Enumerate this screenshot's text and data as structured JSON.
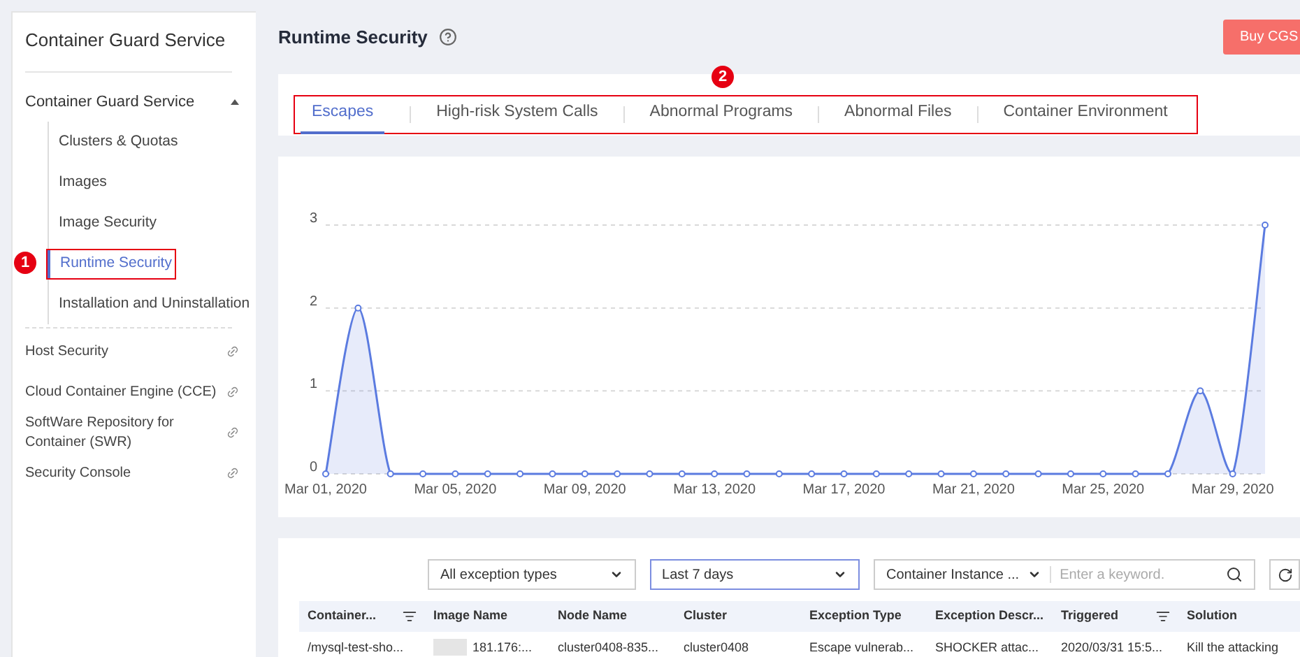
{
  "sidebar": {
    "title": "Container Guard Service",
    "group": {
      "label": "Container Guard Service",
      "expanded": true,
      "items": [
        {
          "label": "Clusters & Quotas",
          "selected": false
        },
        {
          "label": "Images",
          "selected": false
        },
        {
          "label": "Image Security",
          "selected": false
        },
        {
          "label": "Runtime Security",
          "selected": true,
          "annotation": "1"
        },
        {
          "label": "Installation and Uninstallation",
          "selected": false
        }
      ]
    },
    "links": [
      "Host Security",
      "Cloud Container Engine (CCE)",
      "SoftWare Repository for Container (SWR)",
      "Security Console"
    ]
  },
  "header": {
    "title": "Runtime Security",
    "buy_button": "Buy CGS"
  },
  "tabs": {
    "annotation": "2",
    "items": [
      {
        "label": "Escapes",
        "selected": true
      },
      {
        "label": "High-risk System Calls",
        "selected": false
      },
      {
        "label": "Abnormal Programs",
        "selected": false
      },
      {
        "label": "Abnormal Files",
        "selected": false
      },
      {
        "label": "Container Environment",
        "selected": false
      }
    ]
  },
  "chart_data": {
    "type": "area",
    "categories": [
      "Mar 01, 2020",
      null,
      null,
      null,
      "Mar 05, 2020",
      null,
      null,
      null,
      "Mar 09, 2020",
      null,
      null,
      null,
      "Mar 13, 2020",
      null,
      null,
      null,
      "Mar 17, 2020",
      null,
      null,
      null,
      "Mar 21, 2020",
      null,
      null,
      null,
      "Mar 25, 2020",
      null,
      null,
      null,
      "Mar 29, 2020",
      null
    ],
    "series": [
      {
        "color": "#5b7be0",
        "values": [
          0,
          2,
          0,
          0,
          0,
          0,
          0,
          0,
          0,
          0,
          0,
          0,
          0,
          0,
          0,
          0,
          0,
          0,
          0,
          0,
          0,
          0,
          0,
          0,
          0,
          0,
          0,
          1,
          0,
          3
        ]
      }
    ],
    "ylim": [
      0,
      3
    ],
    "yticks": [
      0,
      1,
      2,
      3
    ]
  },
  "filters": {
    "type_select": "All exception types",
    "time_select": "Last 7 days",
    "search_scope": "Container Instance ...",
    "search_placeholder": "Enter a keyword."
  },
  "table": {
    "columns": [
      {
        "label": "Container...",
        "sortable": true
      },
      {
        "label": "Image Name",
        "sortable": false
      },
      {
        "label": "Node Name",
        "sortable": false
      },
      {
        "label": "Cluster",
        "sortable": false
      },
      {
        "label": "Exception Type",
        "sortable": false
      },
      {
        "label": "Exception Descr...",
        "sortable": false
      },
      {
        "label": "Triggered",
        "sortable": true
      },
      {
        "label": "Solution",
        "sortable": false
      }
    ],
    "rows": [
      [
        "/mysql-test-sho...",
        "181.176:...",
        "cluster0408-835...",
        "cluster0408",
        "Escape vulnerab...",
        "SHOCKER attac...",
        "2020/03/31 15:5...",
        "Kill the attacking"
      ]
    ]
  }
}
